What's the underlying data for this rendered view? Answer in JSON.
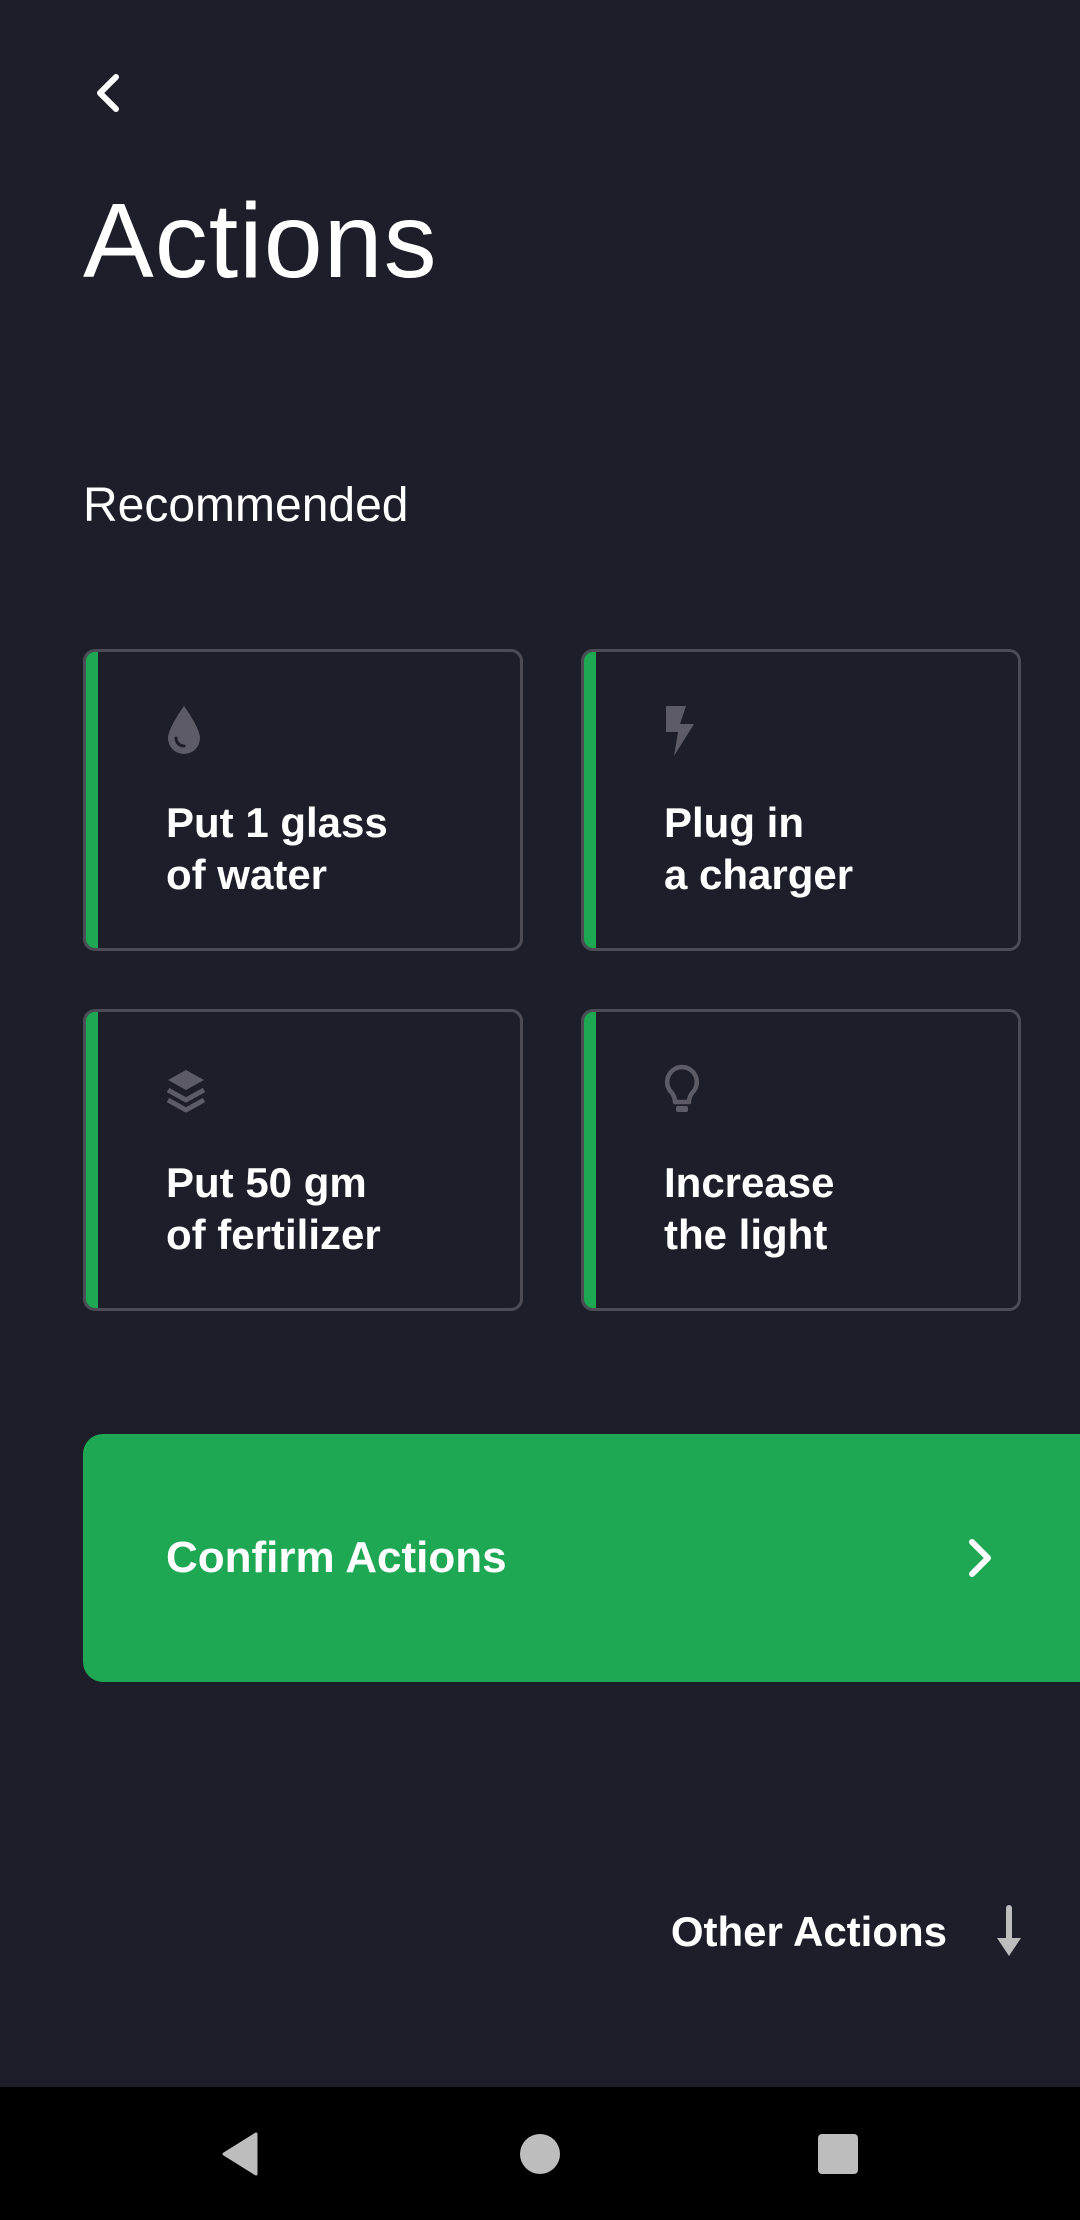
{
  "header": {
    "title": "Actions",
    "back_icon": "chevron-left-icon"
  },
  "recommended": {
    "title": "Recommended",
    "cards": [
      {
        "line1": "Put 1 glass",
        "line2": "of water",
        "icon": "water-drop-icon"
      },
      {
        "line1": "Plug in",
        "line2": "a charger",
        "icon": "lightning-icon"
      },
      {
        "line1": "Put 50 gm",
        "line2": "of fertilizer",
        "icon": "layers-icon"
      },
      {
        "line1": "Increase",
        "line2": "the light",
        "icon": "lightbulb-icon"
      }
    ]
  },
  "confirm": {
    "label": "Confirm Actions",
    "icon": "chevron-right-icon"
  },
  "other": {
    "label": "Other Actions",
    "icon": "arrow-down-icon"
  },
  "navbar": {
    "back_icon": "nav-back-icon",
    "home_icon": "nav-home-icon",
    "recents_icon": "nav-recents-icon"
  },
  "colors": {
    "background": "#1e1d2a",
    "accent_green": "#1ea854",
    "card_border": "#4d4c56",
    "icon_gray": "#5d5c66",
    "text": "#ffffff",
    "navbar": "#000000",
    "nav_icon": "#bdbdbd"
  }
}
